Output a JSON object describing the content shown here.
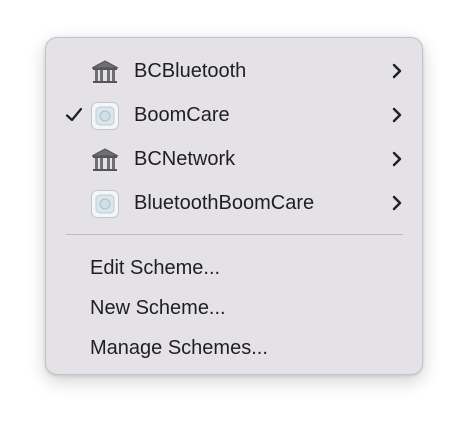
{
  "menu": {
    "schemes": [
      {
        "label": "BCBluetooth",
        "icon": "library-icon",
        "checked": false
      },
      {
        "label": "BoomCare",
        "icon": "app-icon",
        "checked": true
      },
      {
        "label": "BCNetwork",
        "icon": "library-icon",
        "checked": false
      },
      {
        "label": "BluetoothBoomCare",
        "icon": "app-icon",
        "checked": false
      }
    ],
    "actions": [
      {
        "label": "Edit Scheme..."
      },
      {
        "label": "New Scheme..."
      },
      {
        "label": "Manage Schemes..."
      }
    ]
  },
  "colors": {
    "menu_background": "#e4e2e6",
    "text": "#1f1f21",
    "separator": "#bdbbc0"
  }
}
